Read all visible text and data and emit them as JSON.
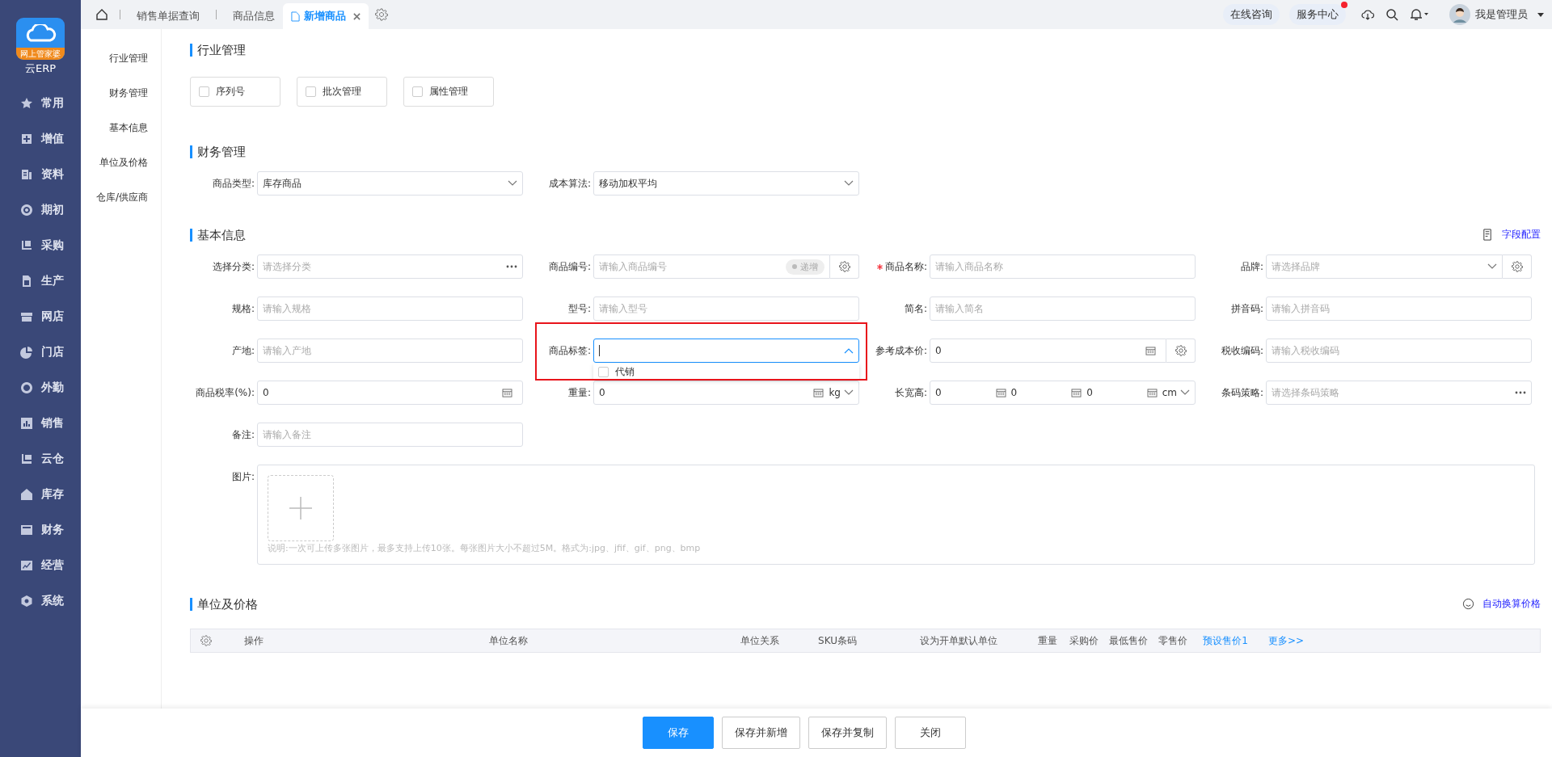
{
  "sidebar": {
    "logo": {
      "badge": "网上管家婆",
      "name": "云ERP"
    },
    "items": [
      {
        "label": "常用"
      },
      {
        "label": "增值"
      },
      {
        "label": "资料"
      },
      {
        "label": "期初"
      },
      {
        "label": "采购"
      },
      {
        "label": "生产"
      },
      {
        "label": "网店"
      },
      {
        "label": "门店"
      },
      {
        "label": "外勤"
      },
      {
        "label": "销售"
      },
      {
        "label": "云仓"
      },
      {
        "label": "库存"
      },
      {
        "label": "财务"
      },
      {
        "label": "经营"
      },
      {
        "label": "系统"
      }
    ]
  },
  "tabs": [
    {
      "label": "销售单据查询",
      "selected": false,
      "closable": false
    },
    {
      "label": "商品信息",
      "selected": false,
      "closable": false
    },
    {
      "label": "新增商品",
      "selected": true,
      "closable": true
    }
  ],
  "top_right": {
    "buttons": [
      {
        "label": "在线咨询",
        "badge": false
      },
      {
        "label": "服务中心",
        "badge": true
      }
    ],
    "user": "我是管理员"
  },
  "anchor_nav": [
    "行业管理",
    "财务管理",
    "基本信息",
    "单位及价格",
    "仓库/供应商"
  ],
  "industry": {
    "title": "行业管理",
    "options": [
      {
        "label": "序列号",
        "checked": false
      },
      {
        "label": "批次管理",
        "checked": false
      },
      {
        "label": "属性管理",
        "checked": false
      }
    ]
  },
  "finance": {
    "title": "财务管理",
    "fields": [
      {
        "label": "商品类型:",
        "kind": "select",
        "value": "库存商品"
      },
      {
        "label": "成本算法:",
        "kind": "select",
        "value": "移动加权平均"
      }
    ]
  },
  "basic": {
    "title": "基本信息",
    "link": "字段配置",
    "fields": [
      {
        "label": "选择分类:",
        "kind": "more",
        "placeholder": "请选择分类"
      },
      {
        "label": "商品编号:",
        "kind": "code",
        "placeholder": "请输入商品编号",
        "toggle": "递增"
      },
      {
        "label": "商品名称:",
        "kind": "input",
        "required": true,
        "placeholder": "请输入商品名称"
      },
      {
        "label": "品牌:",
        "kind": "select-gear",
        "placeholder": "请选择品牌"
      },
      {
        "label": "规格:",
        "kind": "input",
        "placeholder": "请输入规格"
      },
      {
        "label": "型号:",
        "kind": "input",
        "placeholder": "请输入型号"
      },
      {
        "label": "简名:",
        "kind": "input",
        "placeholder": "请输入简名"
      },
      {
        "label": "拼音码:",
        "kind": "input",
        "placeholder": "请输入拼音码"
      },
      {
        "label": "产地:",
        "kind": "input",
        "placeholder": "请输入产地"
      },
      {
        "label": "商品标签:",
        "kind": "tags",
        "highlighted": true,
        "expanded": true,
        "options": [
          {
            "label": "代销",
            "checked": false
          }
        ]
      },
      {
        "label": "参考成本价:",
        "kind": "calc-gear",
        "value": "0"
      },
      {
        "label": "税收编码:",
        "kind": "input",
        "placeholder": "请输入税收编码"
      },
      {
        "label": "商品税率(%):",
        "kind": "calc",
        "value": "0"
      },
      {
        "label": "重量:",
        "kind": "calc-unit",
        "value": "0",
        "unit": "kg"
      },
      {
        "label": "长宽高:",
        "kind": "dims",
        "values": [
          "0",
          "0",
          "0"
        ],
        "unit": "cm"
      },
      {
        "label": "条码策略:",
        "kind": "more",
        "placeholder": "请选择条码策略"
      },
      {
        "label": "备注:",
        "kind": "input",
        "placeholder": "请输入备注"
      },
      {
        "label": "图片:",
        "kind": "image",
        "hint": "说明:一次可上传多张图片，最多支持上传10张。每张图片大小不超过5M。格式为:jpg、jfif、gif、png、bmp"
      }
    ]
  },
  "units": {
    "title": "单位及价格",
    "link": "自动换算价格",
    "columns": [
      "操作",
      "单位名称",
      "单位关系",
      "SKU条码",
      "设为开单默认单位",
      "重量",
      "采购价",
      "最低售价",
      "零售价",
      "预设售价1",
      "更多>>"
    ]
  },
  "footer": [
    {
      "label": "保存",
      "primary": true
    },
    {
      "label": "保存并新增",
      "primary": false
    },
    {
      "label": "保存并复制",
      "primary": false
    },
    {
      "label": "关闭",
      "primary": false
    }
  ]
}
